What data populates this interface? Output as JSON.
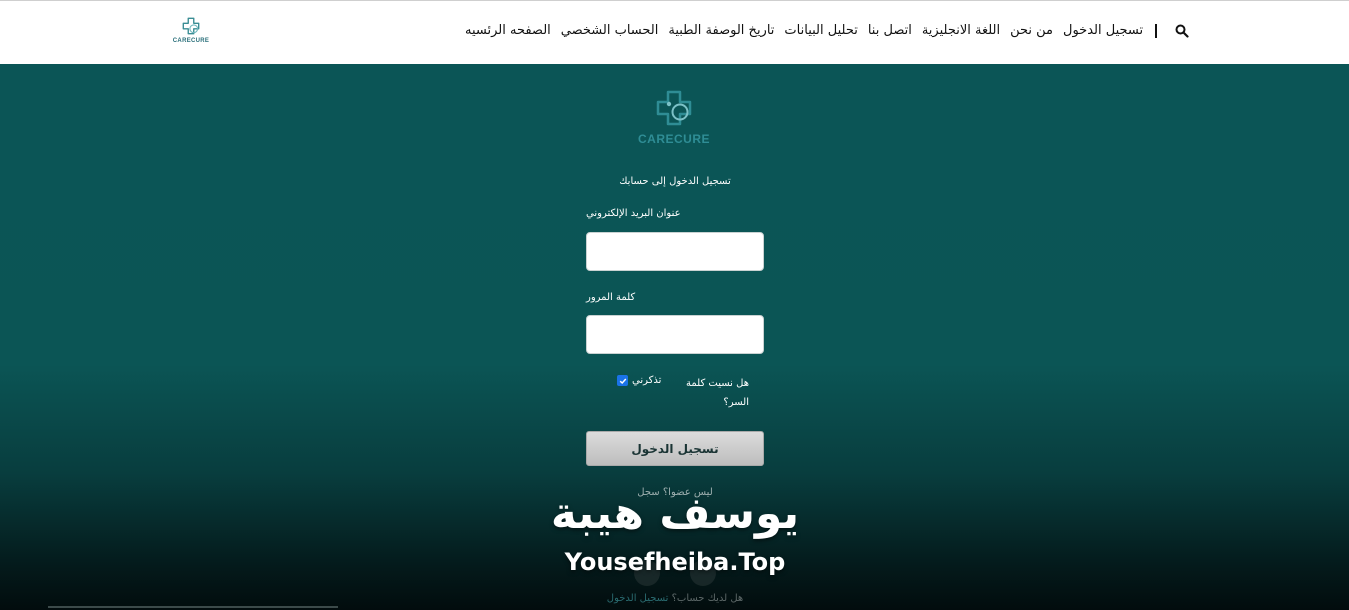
{
  "nav": {
    "brand": "CARECURE",
    "items": [
      "الصفحه الرئسيه",
      "الحساب الشخصي",
      "تاريخ الوصفة الطبية",
      "تحليل البيانات",
      "اتصل بنا",
      "اللغة الانجليزية",
      "من نحن",
      "تسجيل الدخول"
    ]
  },
  "hero": {
    "brand": "CARECURE"
  },
  "form": {
    "title": "تسجيل الدخول إلى حسابك",
    "email_label": "عنوان البريد الإلكتروني",
    "password_label": "كلمة المرور",
    "remember_label": "تذكرني",
    "remember_checked": true,
    "forgot_label": "هل نسيت كلمة السر؟",
    "login_button": "تسجيل الدخول",
    "register_prompt": "ليس عضوا؟ سجل",
    "account_prompt": "هل لديك حساب؟",
    "account_link": "تسجيل الدخول"
  },
  "watermark": {
    "arabic": "يوسف هيبة",
    "latin": "Yousefheiba.Top"
  },
  "colors": {
    "hero_top": "#0b5556",
    "hero_bottom": "#020c0d",
    "accent": "#2f8d95",
    "checkbox": "#1a73e8"
  }
}
